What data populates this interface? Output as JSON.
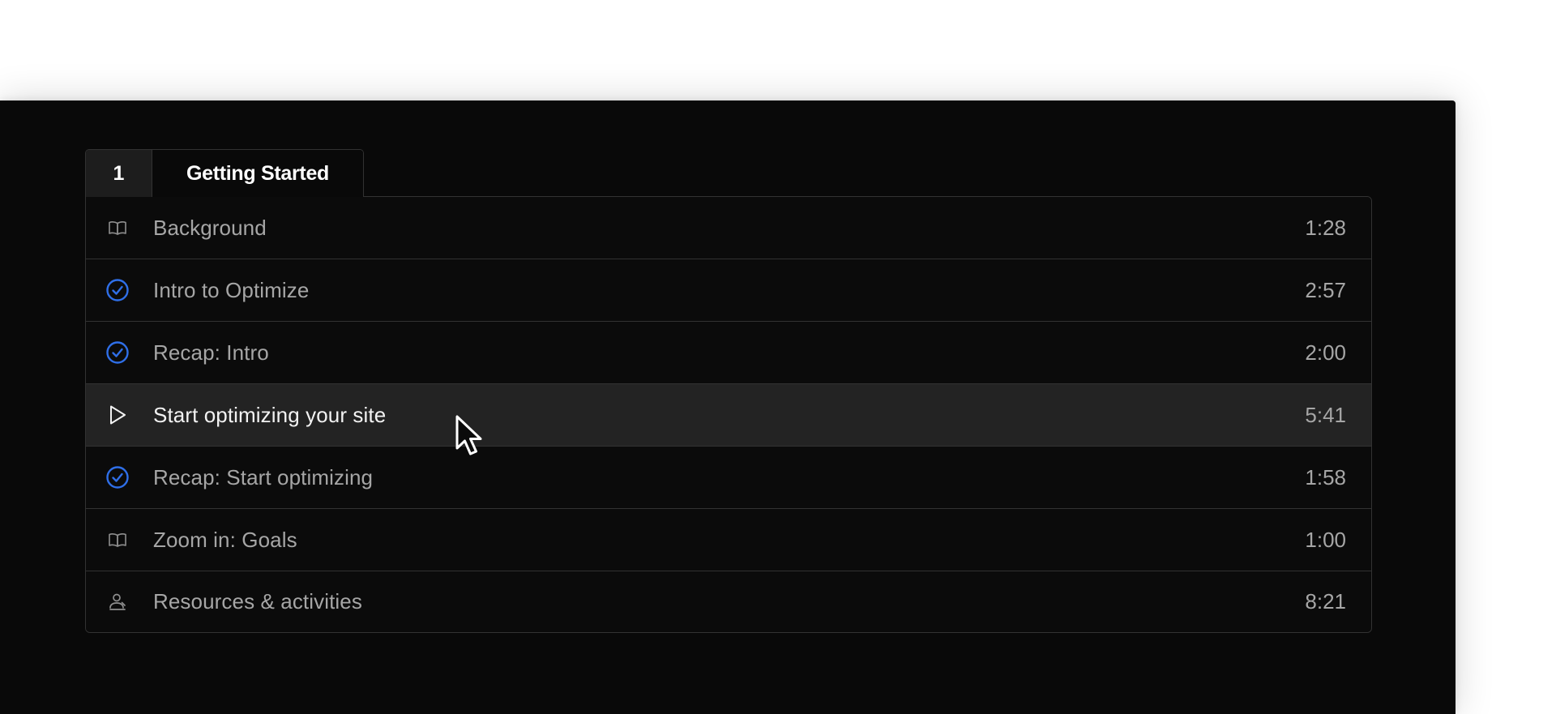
{
  "section": {
    "number": "1",
    "title": "Getting Started"
  },
  "lessons": [
    {
      "icon": "book-open-icon",
      "title": "Background",
      "duration": "1:28",
      "active": false
    },
    {
      "icon": "check-circle-icon",
      "title": "Intro to Optimize",
      "duration": "2:57",
      "active": false
    },
    {
      "icon": "check-circle-icon",
      "title": "Recap: Intro",
      "duration": "2:00",
      "active": false
    },
    {
      "icon": "play-icon",
      "title": "Start optimizing your site",
      "duration": "5:41",
      "active": true
    },
    {
      "icon": "check-circle-icon",
      "title": "Recap: Start optimizing",
      "duration": "1:58",
      "active": false
    },
    {
      "icon": "book-open-icon",
      "title": "Zoom in: Goals",
      "duration": "1:00",
      "active": false
    },
    {
      "icon": "user-activity-icon",
      "title": "Resources & activities",
      "duration": "8:21",
      "active": false
    }
  ],
  "colors": {
    "panel_background": "#090909",
    "active_row": "#232323",
    "completed_check": "#2f6fe8",
    "muted_text": "#a6a6a6",
    "border": "#323232"
  }
}
